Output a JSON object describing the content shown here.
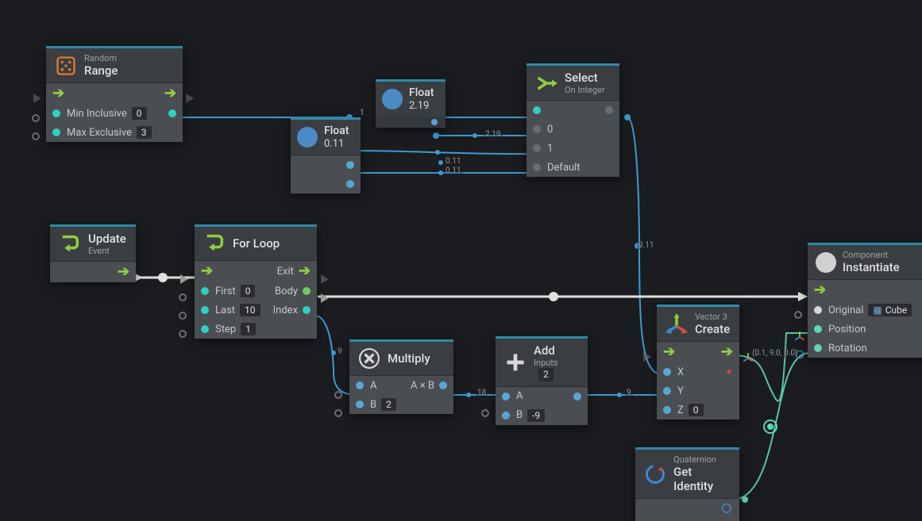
{
  "nodes": {
    "random": {
      "sub": "Random",
      "title": "Range",
      "min_label": "Min Inclusive",
      "min_val": "0",
      "max_label": "Max Exclusive",
      "max_val": "3"
    },
    "float1": {
      "title": "Float",
      "val": "2.19"
    },
    "float2": {
      "title": "Float",
      "val": "0.11"
    },
    "select": {
      "title": "Select",
      "sub": "On Integer",
      "opt0": "0",
      "opt1": "1",
      "default": "Default"
    },
    "update": {
      "title": "Update",
      "sub": "Event"
    },
    "forloop": {
      "title": "For Loop",
      "exit": "Exit",
      "first_label": "First",
      "first_val": "0",
      "body_label": "Body",
      "last_label": "Last",
      "last_val": "10",
      "index_label": "Index",
      "step_label": "Step",
      "step_val": "1"
    },
    "multiply": {
      "title": "Multiply",
      "expr": "A × B",
      "a": "A",
      "b": "B",
      "b_val": "2"
    },
    "add": {
      "title": "Add",
      "inputs_label": "Inputs",
      "inputs_val": "2",
      "a": "A",
      "b": "B",
      "b_val": "-9"
    },
    "vector3": {
      "sub": "Vector 3",
      "title": "Create",
      "x": "X",
      "y": "Y",
      "z": "Z",
      "z_val": "0"
    },
    "quaternion": {
      "sub": "Quaternion",
      "title": "Get Identity"
    },
    "instantiate": {
      "sub": "Component",
      "title": "Instantiate",
      "original": "Original",
      "original_val": "Cube",
      "position": "Position",
      "rotation": "Rotation"
    }
  },
  "wire_labels": {
    "one": "1",
    "two19a": "2.19",
    "o11a": "0.11",
    "o11b": "0.11",
    "o11c": "0.11",
    "nine": "9",
    "eighteen": "18",
    "nine2": "9",
    "vec": "(0.1, 9.0, 0.0)"
  }
}
